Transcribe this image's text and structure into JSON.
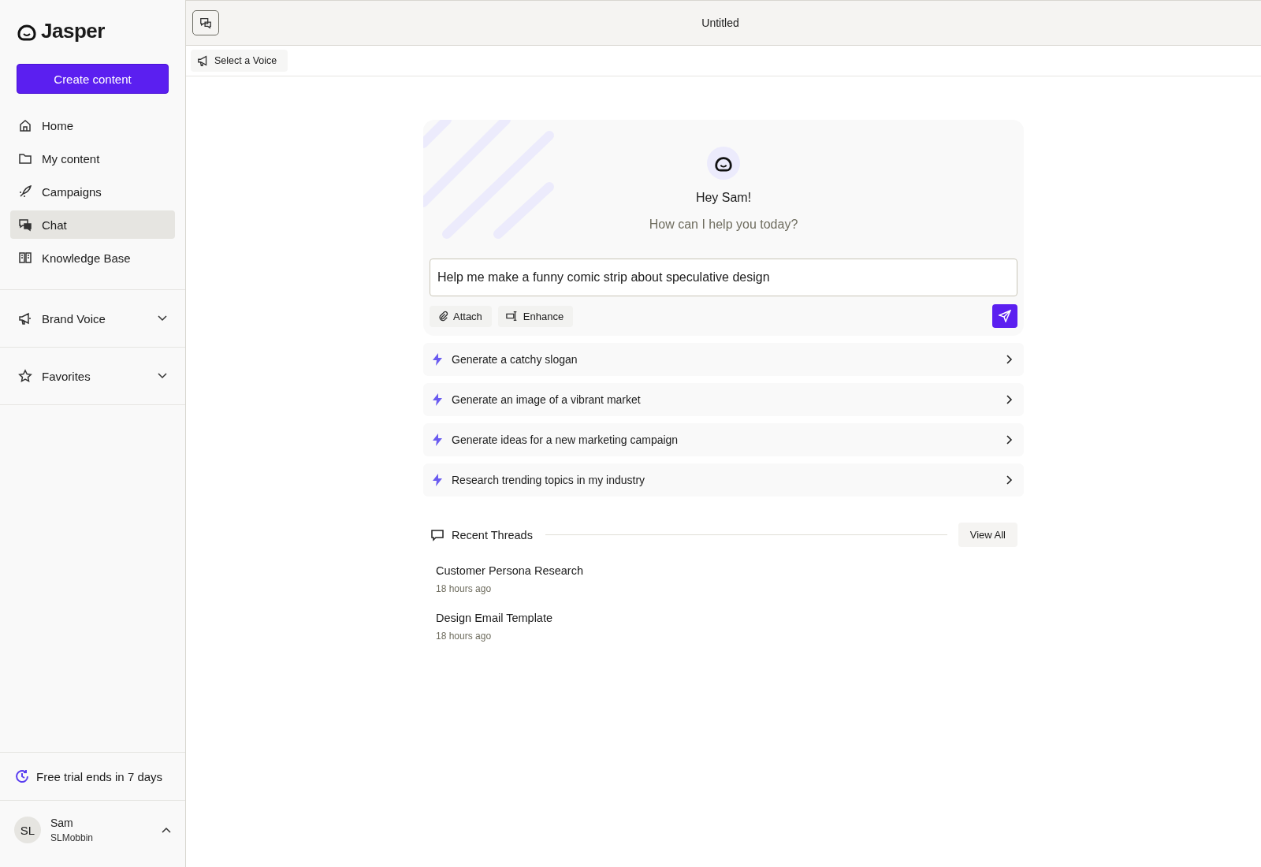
{
  "sidebar": {
    "logo": "Jasper",
    "create_button": "Create content",
    "nav_items": [
      {
        "label": "Home",
        "selected": false
      },
      {
        "label": "My content",
        "selected": false
      },
      {
        "label": "Campaigns",
        "selected": false
      },
      {
        "label": "Chat",
        "selected": true
      },
      {
        "label": "Knowledge Base",
        "selected": false
      }
    ],
    "sections": [
      {
        "label": "Brand Voice",
        "expanded": false
      },
      {
        "label": "Favorites",
        "expanded": false
      }
    ],
    "trial_notice": "Free trial ends in 7 days",
    "user": {
      "initials": "SL",
      "name": "Sam",
      "workspace": "SLMobbin",
      "expanded": true
    }
  },
  "header": {
    "title": "Untitled"
  },
  "toolbar": {
    "voice_button": "Select a Voice"
  },
  "chat": {
    "greeting": "Hey Sam!",
    "subtitle": "How can I help you today?",
    "input_value": "Help me make a funny comic strip about speculative design",
    "attach_button": "Attach",
    "enhance_button": "Enhance",
    "suggestions": [
      "Generate a catchy slogan",
      "Generate an image of a vibrant market",
      "Generate ideas for a new marketing campaign",
      "Research trending topics in my industry"
    ]
  },
  "recent_threads": {
    "title": "Recent Threads",
    "view_all": "View All",
    "threads": [
      {
        "title": "Customer Persona Research",
        "time": "18 hours ago"
      },
      {
        "title": "Design Email Template",
        "time": "18 hours ago"
      }
    ]
  }
}
